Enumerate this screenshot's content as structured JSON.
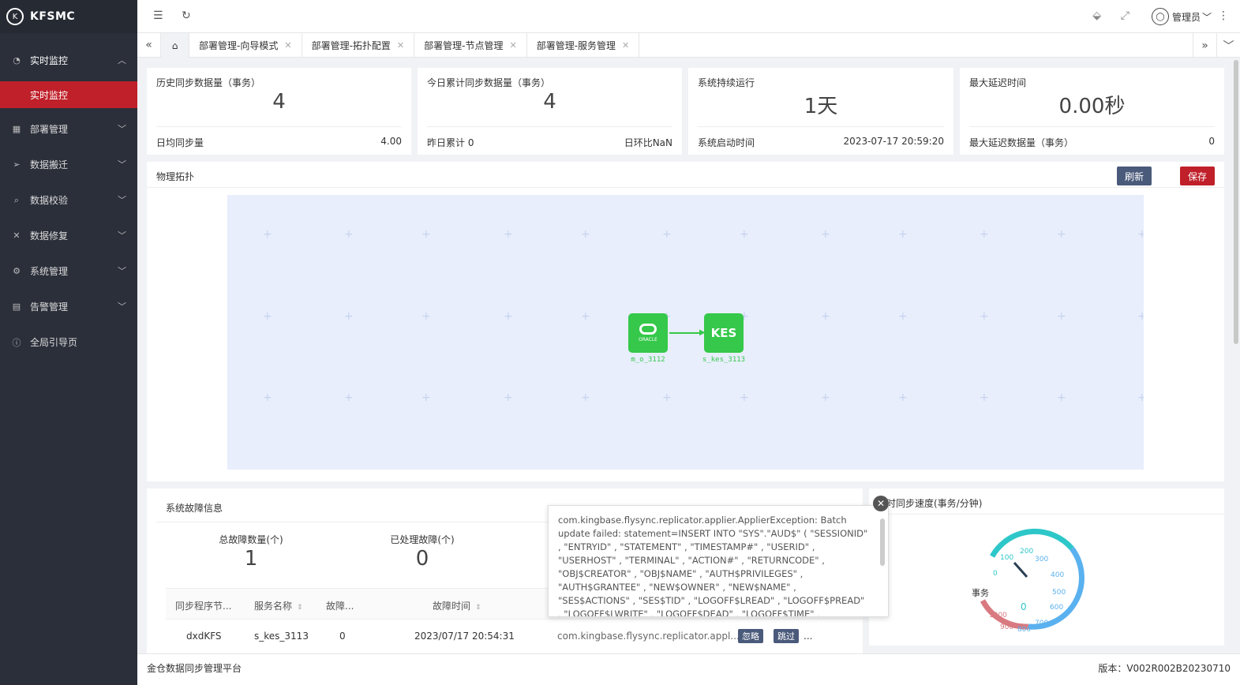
{
  "app": {
    "name": "KFSMC"
  },
  "sidebar": {
    "items": [
      {
        "label": "实时监控",
        "icon": "dashboard-icon",
        "glyph": "◔",
        "open": true
      },
      {
        "label": "部署管理",
        "icon": "grid-icon",
        "glyph": "▦"
      },
      {
        "label": "数据搬迁",
        "icon": "send-icon",
        "glyph": "➢"
      },
      {
        "label": "数据校验",
        "icon": "search-icon",
        "glyph": "⌕"
      },
      {
        "label": "数据修复",
        "icon": "tools-icon",
        "glyph": "✕"
      },
      {
        "label": "系统管理",
        "icon": "gear-icon",
        "glyph": "⚙"
      },
      {
        "label": "告警管理",
        "icon": "alert-icon",
        "glyph": "▤"
      },
      {
        "label": "全局引导页",
        "icon": "info-icon",
        "glyph": "ⓘ"
      }
    ],
    "submenu_active": "实时监控"
  },
  "header": {
    "user": "管理员"
  },
  "tabs": [
    {
      "label": "部署管理-向导模式"
    },
    {
      "label": "部署管理-拓扑配置"
    },
    {
      "label": "部署管理-节点管理"
    },
    {
      "label": "部署管理-服务管理"
    }
  ],
  "stats": [
    {
      "title": "历史同步数据量（事务）",
      "value": "4",
      "foot_left": "日均同步量",
      "foot_right": "4.00"
    },
    {
      "title": "今日累计同步数据量（事务）",
      "value": "4",
      "foot_left": "昨日累计 0",
      "foot_right": "日环比NaN"
    },
    {
      "title": "系统持续运行",
      "value": "1天",
      "foot_left": "系统启动时间",
      "foot_right": "2023-07-17 20:59:20"
    },
    {
      "title": "最大延迟时间",
      "value": "0.00秒",
      "foot_left": "最大延迟数据量（事务）",
      "foot_right": "0"
    }
  ],
  "topology": {
    "title": "物理拓扑",
    "refresh_label": "刷新",
    "save_label": "保存",
    "nodes": [
      {
        "label": "m_o_3112",
        "type": "ORACLE"
      },
      {
        "label": "s_kes_3113",
        "type": "KES"
      }
    ]
  },
  "faults": {
    "title": "系统故障信息",
    "total_label": "总故障数量(个)",
    "total_value": "1",
    "handled_label": "已处理故障(个)",
    "handled_value": "0",
    "columns": [
      "同步程序节...",
      "服务名称",
      "故障...",
      "故障时间"
    ],
    "row": {
      "node": "dxdKFS",
      "service": "s_kes_3113",
      "code": "0",
      "time": "2023/07/17 20:54:31",
      "message": "com.kingbase.flysync.replicator.appl...",
      "ignore_label": "忽略",
      "skip_label": "跳过",
      "more": "..."
    }
  },
  "tooltip": {
    "text": "com.kingbase.flysync.replicator.applier.ApplierException: Batch update failed: statement=INSERT INTO \"SYS\".\"AUD$\" ( \"SESSIONID\" , \"ENTRYID\" , \"STATEMENT\" , \"TIMESTAMP#\" , \"USERID\" , \"USERHOST\" , \"TERMINAL\" , \"ACTION#\" , \"RETURNCODE\" , \"OBJ$CREATOR\" , \"OBJ$NAME\" , \"AUTH$PRIVILEGES\" , \"AUTH$GRANTEE\" , \"NEW$OWNER\" , \"NEW$NAME\" , \"SES$ACTIONS\" , \"SES$TID\" , \"LOGOFF$LREAD\" , \"LOGOFF$PREAD\" , \"LOGOFF$LWRITE\" , \"LOGOFF$DEAD\" , \"LOGOFF$TIME\" , \"COMMENT$TEXT\" , \"CLIENTID\""
  },
  "speed": {
    "title": "时同步速度(事务/分钟)",
    "gauge_label": "事务",
    "value": 0,
    "ticks": [
      "0",
      "100",
      "200",
      "300",
      "400",
      "500",
      "600",
      "700",
      "800",
      "900",
      "1000"
    ],
    "colors": {
      "low": "#2ec7c9",
      "mid": "#5ab1ef",
      "high": "#d87a80"
    }
  },
  "footer": {
    "left": "金仓数据同步管理平台",
    "right": "版本：V002R002B20230710"
  }
}
